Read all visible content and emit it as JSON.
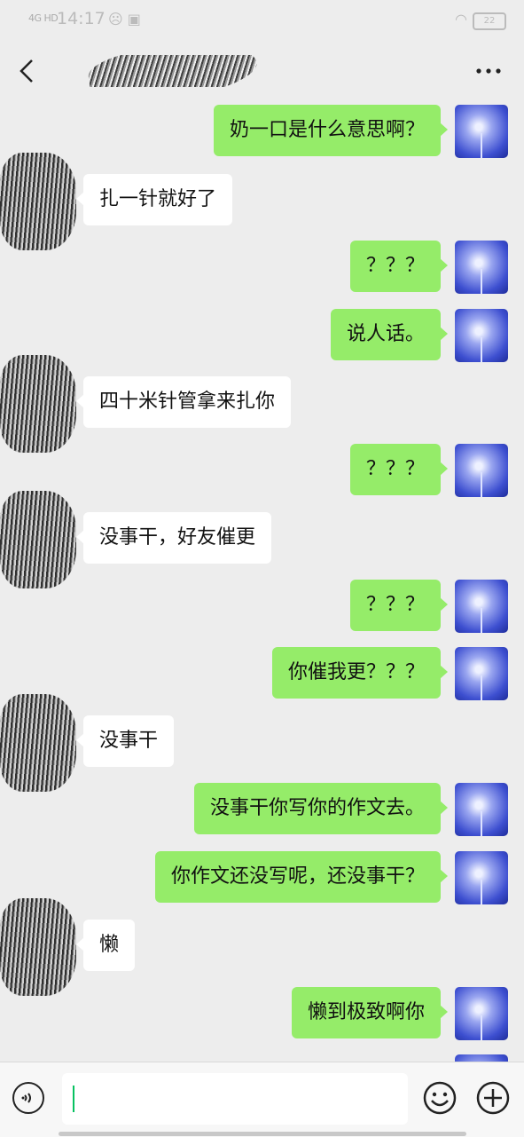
{
  "status_bar": {
    "signal": "4G HD",
    "time": "14:17",
    "battery": "22"
  },
  "header": {
    "title": "",
    "more_label": "···"
  },
  "messages": [
    {
      "side": "right",
      "text": "奶一口是什么意思啊？"
    },
    {
      "side": "left",
      "text": "扎一针就好了"
    },
    {
      "side": "right",
      "text": "？？？"
    },
    {
      "side": "right",
      "text": "说人话。"
    },
    {
      "side": "left",
      "text": "四十米针管拿来扎你"
    },
    {
      "side": "right",
      "text": "？？？"
    },
    {
      "side": "left",
      "text": "没事干，好友催更"
    },
    {
      "side": "right",
      "text": "？？？"
    },
    {
      "side": "right",
      "text": "你催我更？？？"
    },
    {
      "side": "left",
      "text": "没事干"
    },
    {
      "side": "right",
      "text": "没事干你写你的作文去。"
    },
    {
      "side": "right",
      "text": "你作文还没写呢，还没事干？"
    },
    {
      "side": "left",
      "text": "懒"
    },
    {
      "side": "right",
      "text": "懒到极致啊你"
    }
  ],
  "input_bar": {
    "voice_icon": "voice-icon",
    "emoji_icon": "emoji-icon",
    "add_icon": "plus-circle-icon",
    "input_value": ""
  },
  "colors": {
    "self_bubble": "#95ec69",
    "other_bubble": "#ffffff",
    "background": "#ededed",
    "caret": "#07c160"
  }
}
